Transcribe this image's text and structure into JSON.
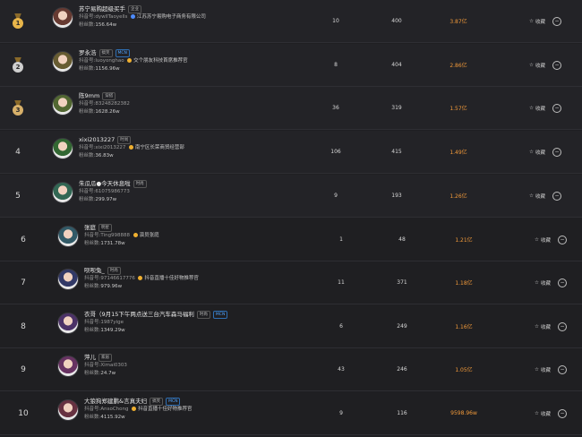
{
  "labels": {
    "douyin_prefix": "抖音号:",
    "followers_prefix": "粉丝数:",
    "favorite": "收藏"
  },
  "colors": {
    "background": "#1f1f22",
    "sales": "#f29a3a",
    "mcn": "#4ea3ff",
    "gold": "#e8b54a"
  },
  "rows": [
    {
      "rank": "1",
      "medal": "gold",
      "name": "苏宁易购超级买手",
      "tag": "企业",
      "mcn": "",
      "douyin_id": "dywllTaoyells",
      "cert": "江苏苏宁易购电子商务有限公司",
      "followers": "156.64w",
      "live": "10",
      "goods": "400",
      "sales": "3.87亿"
    },
    {
      "rank": "2",
      "medal": "silver",
      "name": "罗永浩",
      "tag": "搞笑",
      "mcn": "MCN",
      "douyin_id": "luoyonghao",
      "cert": "交个朋友科技首席推荐官",
      "followers": "1156.96w",
      "live": "8",
      "goods": "404",
      "sales": "2.86亿"
    },
    {
      "rank": "3",
      "medal": "bronze",
      "name": "陈9mm",
      "tag": "穿搭",
      "mcn": "",
      "douyin_id": "83248282382",
      "cert": "",
      "followers": "1628.26w",
      "live": "36",
      "goods": "319",
      "sales": "1.57亿"
    },
    {
      "rank": "4",
      "medal": "",
      "name": "xixi2013227",
      "tag": "时尚",
      "mcn": "",
      "douyin_id": "xixi2013227",
      "cert": "南宁区长荣商贸经营部",
      "followers": "36.83w",
      "live": "106",
      "goods": "415",
      "sales": "1.49亿"
    },
    {
      "rank": "5",
      "medal": "",
      "name": "朱瓜瓜●今天休息啦",
      "tag": "时尚",
      "mcn": "",
      "douyin_id": "61075986773",
      "cert": "",
      "followers": "299.97w",
      "live": "9",
      "goods": "193",
      "sales": "1.26亿"
    },
    {
      "rank": "6",
      "medal": "",
      "name": "张庭",
      "tag": "明星",
      "mcn": "",
      "douyin_id": "Ting998888",
      "cert": "演员张庭",
      "followers": "1731.78w",
      "live": "1",
      "goods": "48",
      "sales": "1.21亿"
    },
    {
      "rank": "7",
      "medal": "",
      "name": "呗呗兔_",
      "tag": "时尚",
      "mcn": "",
      "douyin_id": "97146617776",
      "cert": "抖音直播十佳好物推荐官",
      "followers": "979.96w",
      "live": "11",
      "goods": "371",
      "sales": "1.18亿"
    },
    {
      "rank": "8",
      "medal": "",
      "name": "衣哥（9月15下午两点送三台汽车森马福利",
      "tag": "时尚",
      "mcn": "MCN",
      "douyin_id": "1987yige",
      "cert": "",
      "followers": "1349.29w",
      "live": "6",
      "goods": "249",
      "sales": "1.16亿"
    },
    {
      "rank": "9",
      "medal": "",
      "name": "萍儿",
      "tag": "家居",
      "mcn": "",
      "douyin_id": "Ximai0303",
      "cert": "",
      "followers": "24.7w",
      "live": "43",
      "goods": "246",
      "sales": "1.05亿"
    },
    {
      "rank": "10",
      "medal": "",
      "name": "大狼狗郑建鹏&言真夫妇",
      "tag": "搞笑",
      "mcn": "MCN",
      "douyin_id": "AnsoChong",
      "cert": "抖音直播十佳好物推荐官",
      "followers": "4115.92w",
      "live": "9",
      "goods": "116",
      "sales": "9598.96w"
    }
  ]
}
